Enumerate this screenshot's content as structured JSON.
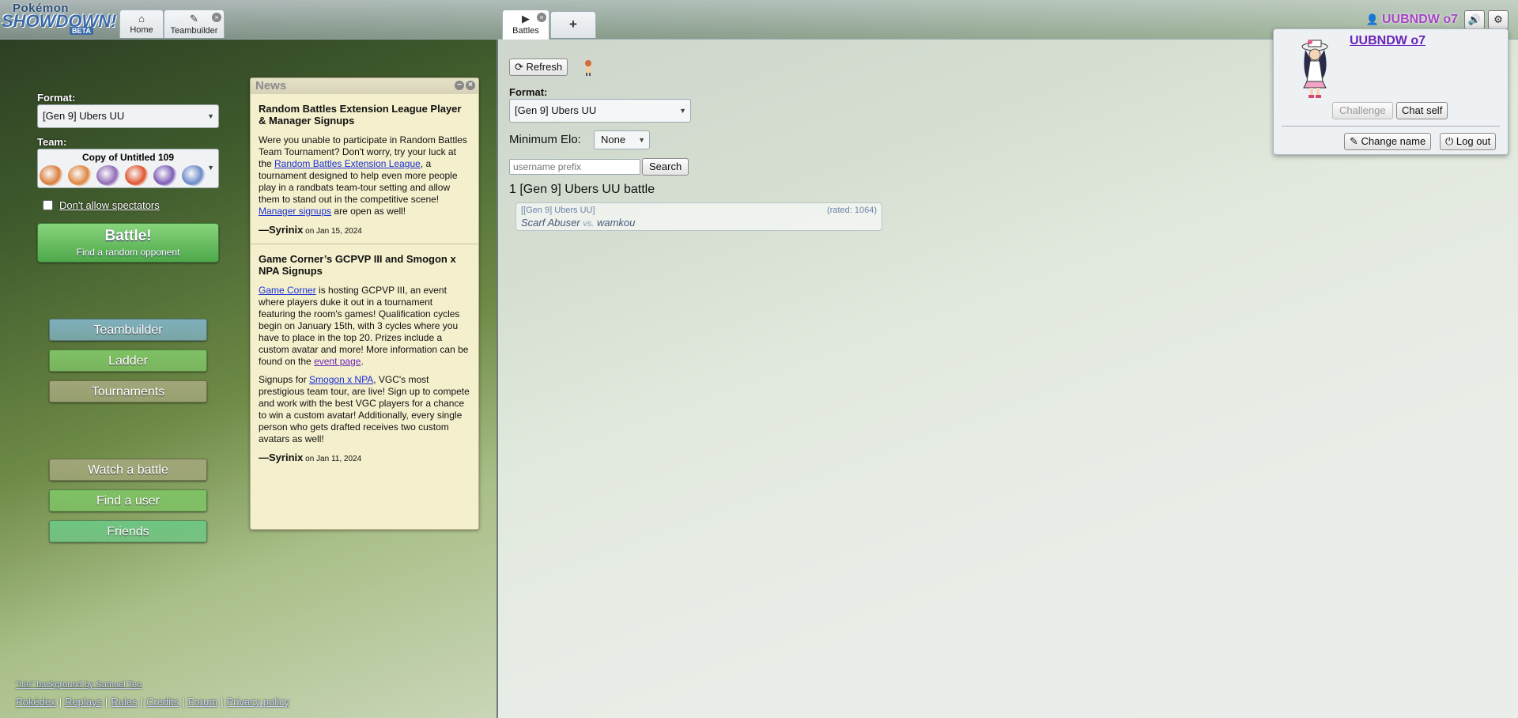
{
  "header": {
    "logo": {
      "top": "Pokémon",
      "main": "SHOWDOWN!",
      "badge": "BETA"
    },
    "tabs": [
      {
        "label": "Home",
        "icon": "home-icon"
      },
      {
        "label": "Teambuilder",
        "icon": "edit-icon"
      },
      {
        "label": "Battles",
        "icon": "play-icon"
      },
      {
        "label": "+",
        "icon": "plus-icon"
      }
    ],
    "username": "UUBNDW o7"
  },
  "left": {
    "format_label": "Format:",
    "format_value": "[Gen 9] Ubers UU",
    "team_label": "Team:",
    "team_name": "Copy of Untitled 109",
    "team_icon_colors": [
      "#d97d3a",
      "#e0853e",
      "#8f6ab5",
      "#e0552e",
      "#7d5bb5",
      "#6b8ac8"
    ],
    "spectators_label": "Don't allow spectators",
    "battle_button": {
      "title": "Battle!",
      "subtitle": "Find a random opponent"
    },
    "menu": [
      {
        "label": "Teambuilder",
        "color": "#7fb0bd"
      },
      {
        "label": "Ladder",
        "color": "#7fc265"
      },
      {
        "label": "Tournaments",
        "color": "#a2a67a"
      },
      {
        "label": "Watch a battle",
        "color": "#a2a67a"
      },
      {
        "label": "Find a user",
        "color": "#7fc265"
      },
      {
        "label": "Friends",
        "color": "#6fc583"
      }
    ],
    "credit": "\"Irie\" background by Samuel Teo",
    "footer_links": [
      "Pokédex",
      "Replays",
      "Rules",
      "Credits",
      "Forum",
      "Privacy policy"
    ]
  },
  "news": {
    "title": "News",
    "items": [
      {
        "title": "Random Battles Extension League Player & Manager Signups",
        "p1_a": "Were you unable to participate in Random Battles Team Tournament? Don't worry, try your luck at the ",
        "p1_link": "Random Battles Extension League",
        "p1_b": ", a tournament designed to help even more people play in a randbats team-tour setting and allow them to stand out in the competitive scene! ",
        "p1_link2": "Manager signups",
        "p1_c": " are open as well!",
        "author": "—Syrinix",
        "date": " on Jan 15, 2024"
      },
      {
        "title": "Game Corner’s GCPVP III and Smogon x NPA Signups",
        "p1_link": "Game Corner",
        "p1_a": " is hosting GCPVP III, an event where players duke it out in a tournament featuring the room's games! Qualification cycles begin on January 15th, with 3 cycles where you have to place in the top 20. Prizes include a custom avatar and more! More information can be found on the ",
        "p1_link2": "event page",
        "p1_b": ".",
        "p2_a": "Signups for ",
        "p2_link": "Smogon x NPA",
        "p2_b": ", VGC's most prestigious team tour, are live! Sign up to compete and work with the best VGC players for a chance to win a custom avatar! Additionally, every single person who gets drafted receives two custom avatars as well!",
        "author": "—Syrinix",
        "date": " on Jan 11, 2024"
      }
    ]
  },
  "battles": {
    "refresh_label": "Refresh",
    "format_label": "Format:",
    "format_value": "[Gen 9] Ubers UU",
    "min_elo_label": "Minimum Elo:",
    "min_elo_value": "None",
    "search_placeholder": "username prefix",
    "search_label": "Search",
    "count_text": "1 [Gen 9] Ubers UU battle",
    "list": [
      {
        "format": "[[Gen 9] Ubers UU]",
        "rated": "(rated: 1064)",
        "p1": "Scarf Abuser",
        "vs": "vs.",
        "p2": "wamkou"
      }
    ]
  },
  "user_popup": {
    "name": "UUBNDW o7",
    "challenge": "Challenge",
    "chat_self": "Chat self",
    "change_name": "Change name",
    "log_out": "Log out"
  }
}
